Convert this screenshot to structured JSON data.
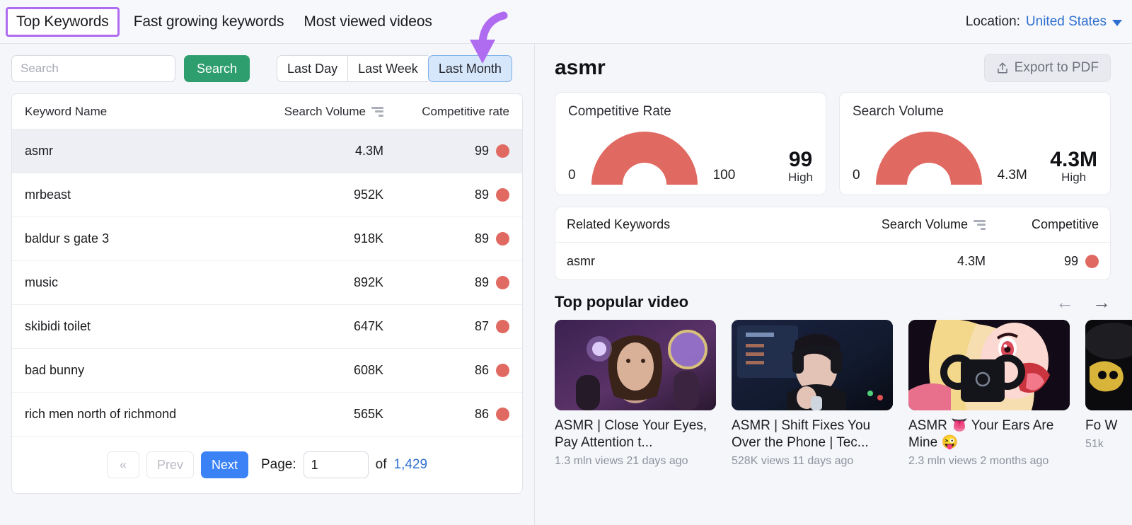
{
  "tabs": [
    {
      "label": "Top Keywords",
      "active": true
    },
    {
      "label": "Fast growing keywords",
      "active": false
    },
    {
      "label": "Most viewed videos",
      "active": false
    }
  ],
  "location": {
    "label": "Location:",
    "value": "United States"
  },
  "search": {
    "placeholder": "Search",
    "value": "",
    "button": "Search"
  },
  "period": {
    "options": [
      "Last Day",
      "Last Week",
      "Last Month"
    ],
    "selected": "Last Month"
  },
  "keyword_table": {
    "columns": [
      "Keyword Name",
      "Search Volume",
      "Competitive rate"
    ],
    "rows": [
      {
        "name": "asmr",
        "volume": "4.3M",
        "competitive": "99",
        "selected": true
      },
      {
        "name": "mrbeast",
        "volume": "952K",
        "competitive": "89",
        "selected": false
      },
      {
        "name": "baldur s gate 3",
        "volume": "918K",
        "competitive": "89",
        "selected": false
      },
      {
        "name": "music",
        "volume": "892K",
        "competitive": "89",
        "selected": false
      },
      {
        "name": "skibidi toilet",
        "volume": "647K",
        "competitive": "87",
        "selected": false
      },
      {
        "name": "bad bunny",
        "volume": "608K",
        "competitive": "86",
        "selected": false
      },
      {
        "name": "rich men north of richmond",
        "volume": "565K",
        "competitive": "86",
        "selected": false
      }
    ]
  },
  "pagination": {
    "first_label": "«",
    "prev_label": "Prev",
    "next_label": "Next",
    "page_label": "Page:",
    "page_value": "1",
    "of_label": "of",
    "total_pages": "1,429"
  },
  "detail": {
    "keyword": "asmr",
    "export_label": "Export to PDF",
    "gauges": [
      {
        "label": "Competitive Rate",
        "min": "0",
        "max": "100",
        "value": "99",
        "rating": "High",
        "percent": 99
      },
      {
        "label": "Search Volume",
        "min": "0",
        "max": "4.3M",
        "value": "4.3M",
        "rating": "High",
        "percent": 100
      }
    ],
    "related": {
      "columns": [
        "Related Keywords",
        "Search Volume",
        "Competitive"
      ],
      "rows": [
        {
          "name": "asmr",
          "volume": "4.3M",
          "competitive": "99"
        }
      ]
    },
    "videos_title": "Top popular video",
    "videos": [
      {
        "title": "ASMR | Close Your Eyes, Pay Attention t...",
        "meta": "1.3 mln views 21 days ago"
      },
      {
        "title": "ASMR | Shift Fixes You Over the Phone | Tec...",
        "meta": "528K views 11 days ago"
      },
      {
        "title": "ASMR 👅 Your Ears Are Mine 😜",
        "meta": "2.3 mln views 2 months ago"
      },
      {
        "title": "Fo W",
        "meta": "51k"
      }
    ]
  },
  "colors": {
    "accent_purple": "#b06cf0",
    "search_green": "#2f9e6e",
    "next_blue": "#3b82f6",
    "link_blue": "#2f6fd0",
    "gauge_red": "#e06a62",
    "selected_seg": "#d7e7fb"
  }
}
